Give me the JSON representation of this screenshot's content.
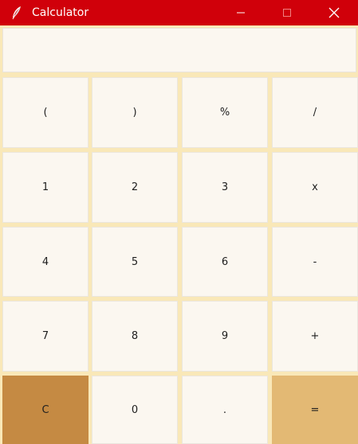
{
  "window": {
    "title": "Calculator",
    "icon": "feather-icon",
    "titlebar_color": "#d0000a",
    "controls": [
      "minimize-icon",
      "maximize-icon",
      "close-icon"
    ]
  },
  "display": {
    "value": ""
  },
  "colors": {
    "background": "#f9e8b8",
    "key": "#fbf7f0",
    "clear_key": "#c58a43",
    "equals_key": "#e3b974"
  },
  "keys": [
    [
      "(",
      ")",
      "%",
      "/"
    ],
    [
      "1",
      "2",
      "3",
      "x"
    ],
    [
      "4",
      "5",
      "6",
      "-"
    ],
    [
      "7",
      "8",
      "9",
      "+"
    ],
    [
      "C",
      "0",
      ".",
      "="
    ]
  ]
}
